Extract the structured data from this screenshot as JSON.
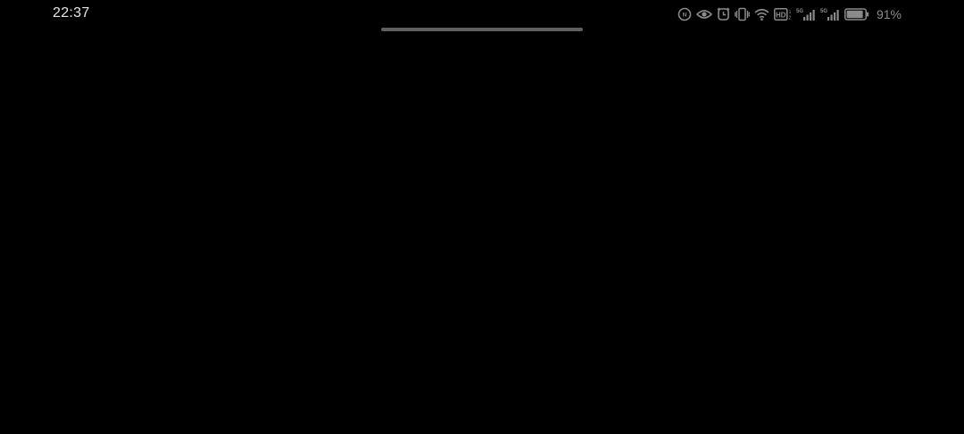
{
  "status_bar": {
    "time": "22:37",
    "battery_percent": "91%",
    "battery_level": 0.91,
    "icons": [
      "nfc-icon",
      "eye-comfort-icon",
      "alarm-icon",
      "vibrate-icon",
      "wifi-icon",
      "hd-voice-icon",
      "signal-5g-sim1-icon",
      "signal-5g-sim2-icon",
      "battery-icon"
    ]
  },
  "colors": {
    "background": "#000000",
    "status_text": "#e6e6e6",
    "status_icons": "#8a8a8a",
    "home_indicator": "#5f5f5f"
  }
}
